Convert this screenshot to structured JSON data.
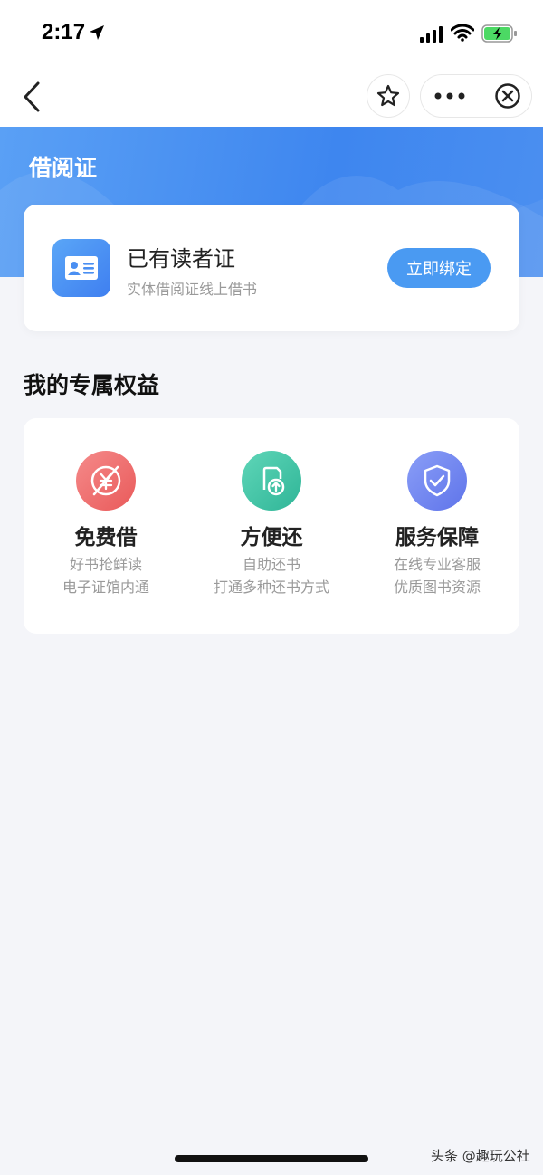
{
  "status_bar": {
    "time": "2:17"
  },
  "header": {
    "title": "借阅证"
  },
  "reader_card": {
    "title": "已有读者证",
    "subtitle": "实体借阅证线上借书",
    "bind_label": "立即绑定"
  },
  "section": {
    "title": "我的专属权益"
  },
  "benefits": [
    {
      "title": "免费借",
      "lines": [
        "好书抢鲜读",
        "电子证馆内通"
      ],
      "icon": "free-borrow-icon",
      "color": "#ef6b6b"
    },
    {
      "title": "方便还",
      "lines": [
        "自助还书",
        "打通多种还书方式"
      ],
      "icon": "return-book-icon",
      "color": "#3ec5a6"
    },
    {
      "title": "服务保障",
      "lines": [
        "在线专业客服",
        "优质图书资源"
      ],
      "icon": "shield-check-icon",
      "color": "#6f86f2"
    }
  ],
  "watermark": "头条 @趣玩公社",
  "colors": {
    "accent": "#4a9af2",
    "background": "#f4f5f9"
  }
}
